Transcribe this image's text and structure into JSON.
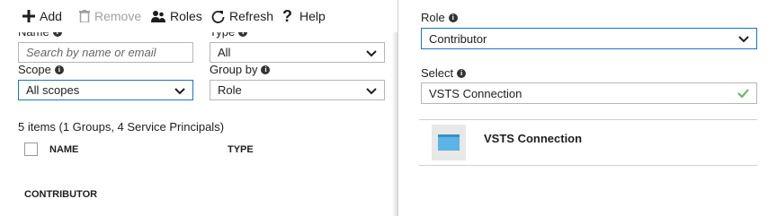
{
  "toolbar": {
    "add_label": "Add",
    "remove_label": "Remove",
    "roles_label": "Roles",
    "refresh_label": "Refresh",
    "help_label": "Help"
  },
  "filters": {
    "name_label": "Name",
    "name_placeholder": "Search by name or email",
    "type_label": "Type",
    "type_value": "All",
    "scope_label": "Scope",
    "scope_value": "All scopes",
    "groupby_label": "Group by",
    "groupby_value": "Role"
  },
  "list": {
    "count_text": "5 items (1 Groups, 4 Service Principals)",
    "columns": [
      "NAME",
      "TYPE"
    ],
    "section_header": "CONTRIBUTOR"
  },
  "panel": {
    "role_label": "Role",
    "role_value": "Contributor",
    "select_label": "Select",
    "select_value": "VSTS Connection",
    "results": [
      {
        "label": "VSTS Connection"
      }
    ]
  },
  "colors": {
    "focus_border": "#1a73c8",
    "check_green": "#5cb85c",
    "icon_blue": "#5ab4e5"
  },
  "icons": [
    "plus-icon",
    "trash-icon",
    "people-icon",
    "refresh-icon",
    "help-icon",
    "info-icon",
    "chevron-down-icon",
    "checkmark-icon",
    "app-icon"
  ]
}
